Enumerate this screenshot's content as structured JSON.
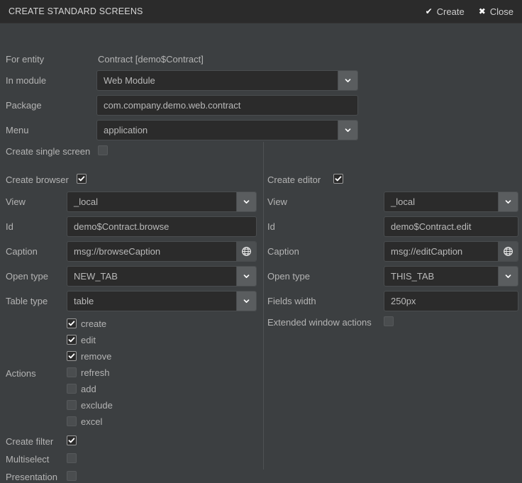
{
  "window": {
    "title": "CREATE STANDARD SCREENS",
    "actions": [
      {
        "label": "Create",
        "glyph": "✔",
        "name": "create"
      },
      {
        "label": "Close",
        "glyph": "✖",
        "name": "close"
      }
    ]
  },
  "top": {
    "for_entity": {
      "label": "For entity",
      "value": "Contract [demo$Contract]"
    },
    "in_module": {
      "label": "In module",
      "value": "Web Module"
    },
    "package": {
      "label": "Package",
      "value": "com.company.demo.web.contract"
    },
    "menu": {
      "label": "Menu",
      "value": "application"
    },
    "create_single_screen": {
      "label": "Create single screen",
      "checked": false
    }
  },
  "browser": {
    "title": "Create browser",
    "enabled": true,
    "view": {
      "label": "View",
      "value": "_local"
    },
    "id": {
      "label": "Id",
      "value": "demo$Contract.browse"
    },
    "caption": {
      "label": "Caption",
      "value": "msg://browseCaption"
    },
    "open_type": {
      "label": "Open type",
      "value": "NEW_TAB"
    },
    "table_type": {
      "label": "Table type",
      "value": "table"
    },
    "actions_label": "Actions",
    "actions": [
      {
        "label": "create",
        "checked": true
      },
      {
        "label": "edit",
        "checked": true
      },
      {
        "label": "remove",
        "checked": true
      },
      {
        "label": "refresh",
        "checked": false
      },
      {
        "label": "add",
        "checked": false
      },
      {
        "label": "exclude",
        "checked": false
      },
      {
        "label": "excel",
        "checked": false
      }
    ],
    "create_filter": {
      "label": "Create filter",
      "checked": true
    },
    "multiselect": {
      "label": "Multiselect",
      "checked": false
    },
    "presentation": {
      "label": "Presentation",
      "checked": false
    }
  },
  "editor": {
    "title": "Create editor",
    "enabled": true,
    "view": {
      "label": "View",
      "value": "_local"
    },
    "id": {
      "label": "Id",
      "value": "demo$Contract.edit"
    },
    "caption": {
      "label": "Caption",
      "value": "msg://editCaption"
    },
    "open_type": {
      "label": "Open type",
      "value": "THIS_TAB"
    },
    "fields_width": {
      "label": "Fields width",
      "value": "250px"
    },
    "extended_window_actions": {
      "label": "Extended window actions",
      "checked": false
    }
  },
  "icons": {
    "globe": "globe-icon",
    "chevron": "chevron-down-icon"
  },
  "colors": {
    "window_bg": "#3c3f41",
    "titlebar_bg": "#2b2b2b",
    "field_bg": "#2b2b2b",
    "combo_btn": "#5a5d5f",
    "text": "#b4b4b4",
    "divider": "#4e5254"
  }
}
